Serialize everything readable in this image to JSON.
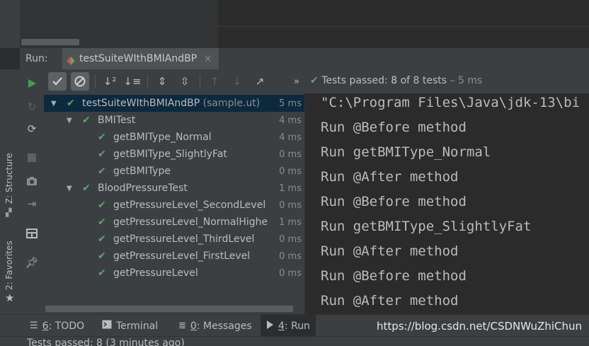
{
  "run_window": {
    "label": "Run:",
    "tab_label": "testSuiteWIthBMIAndBP",
    "tab_close": "×"
  },
  "sidebar_left": {
    "structure_label": "Z: Structure",
    "favorites_label": "2: Favorites"
  },
  "status": {
    "prefix": "Tests passed: ",
    "passed": "8",
    "of_text": " of 8 tests",
    "duration": " – 5 ms"
  },
  "tree": [
    {
      "name": "testSuiteWIthBMIAndBP",
      "location": " (sample.ut)",
      "duration": "5 ms",
      "level": 0,
      "expanded": true,
      "selected": true
    },
    {
      "name": "BMITest",
      "location": "",
      "duration": "4 ms",
      "level": 1,
      "expanded": true
    },
    {
      "name": "getBMIType_Normal",
      "location": "",
      "duration": "4 ms",
      "level": 2
    },
    {
      "name": "getBMIType_SlightlyFat",
      "location": "",
      "duration": "0 ms",
      "level": 2
    },
    {
      "name": "getBMIType",
      "location": "",
      "duration": "0 ms",
      "level": 2
    },
    {
      "name": "BloodPressureTest",
      "location": "",
      "duration": "1 ms",
      "level": 1,
      "expanded": true
    },
    {
      "name": "getPressureLevel_SecondLevel",
      "location": "",
      "duration": "0 ms",
      "level": 2
    },
    {
      "name": "getPressureLevel_NormalHighe",
      "location": "",
      "duration": "1 ms",
      "level": 2
    },
    {
      "name": "getPressureLevel_ThirdLevel",
      "location": "",
      "duration": "0 ms",
      "level": 2
    },
    {
      "name": "getPressureLevel_FirstLevel",
      "location": "",
      "duration": "0 ms",
      "level": 2
    },
    {
      "name": "getPressureLevel",
      "location": "",
      "duration": "0 ms",
      "level": 2
    }
  ],
  "console": {
    "lines": [
      "\"C:\\Program Files\\Java\\jdk-13\\bi",
      "Run @Before method",
      "Run getBMIType_Normal",
      "Run @After method",
      "Run @Before method",
      "Run getBMIType_SlightlyFat",
      "Run @After method",
      "Run @Before method",
      "Run @After method"
    ]
  },
  "bottom_tabs": [
    {
      "mnemonic": "6",
      "label": ": TODO",
      "icon": "list-icon"
    },
    {
      "mnemonic": "",
      "label": "Terminal",
      "icon": "terminal-icon"
    },
    {
      "mnemonic": "0",
      "label": ": Messages",
      "icon": "messages-icon"
    },
    {
      "mnemonic": "4",
      "label": ": Run",
      "icon": "run-icon",
      "active": true
    }
  ],
  "watermark": "https://blog.csdn.net/CSDNWuZhiChun",
  "status_bar": {
    "text": "Tests passed: 8 (3 minutes ago)"
  },
  "colors": {
    "pass_green": "#59a869",
    "run_green": "#499c54",
    "selection": "#0d293e",
    "panel": "#3c3f41",
    "console_bg": "#2b2b2b"
  }
}
